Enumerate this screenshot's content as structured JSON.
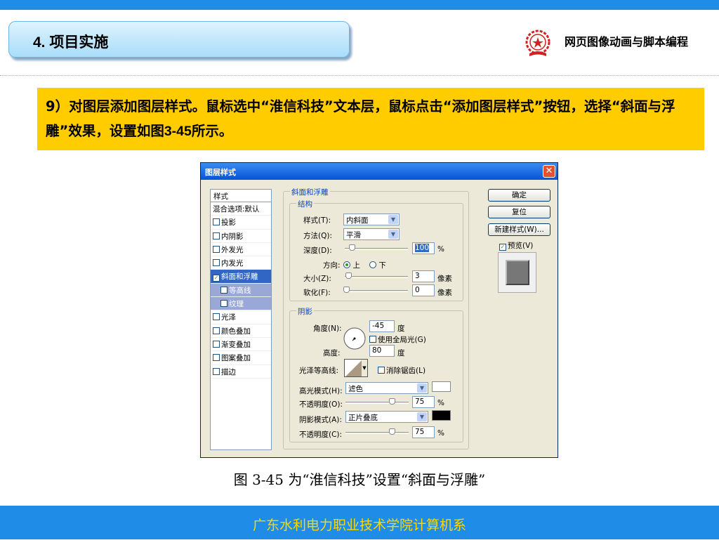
{
  "slide": {
    "title": "4. 项目实施",
    "course_name": "网页图像动画与脚本编程",
    "instruction_num": "9",
    "instruction_text": "）对图层添加图层样式。鼠标选中“淮信科技”文本层，鼠标点击“添加图层样式”按钮，选择“斜面与浮雕”效果，设置如图",
    "instruction_fig": "3-45",
    "instruction_end": "所示。",
    "caption": "图 3-45  为“淮信科技”设置“斜面与浮雕”",
    "footer": "广东水利电力职业技术学院计算机系"
  },
  "dialog": {
    "title": "图层样式",
    "close_glyph": "✕",
    "styles_header": "样式",
    "blend_options": "混合选项:默认",
    "style_items": [
      "投影",
      "内阴影",
      "外发光",
      "内发光",
      "斜面和浮雕",
      "等高线",
      "纹理",
      "光泽",
      "颜色叠加",
      "渐变叠加",
      "图案叠加",
      "描边"
    ],
    "bevel_group": "斜面和浮雕",
    "structure_group": "结构",
    "style_label": "样式(T):",
    "style_value": "内斜面",
    "technique_label": "方法(Q):",
    "technique_value": "平滑",
    "depth_label": "深度(D):",
    "depth_value": "100",
    "depth_unit": "%",
    "direction_label": "方向:",
    "direction_up": "上",
    "direction_down": "下",
    "size_label": "大小(Z):",
    "size_value": "3",
    "size_unit": "像素",
    "soften_label": "软化(F):",
    "soften_value": "0",
    "soften_unit": "像素",
    "shading_group": "阴影",
    "angle_label": "角度(N):",
    "angle_value": "-45",
    "angle_unit": "度",
    "global_light": "使用全局光(G)",
    "altitude_label": "高度:",
    "altitude_value": "80",
    "altitude_unit": "度",
    "gloss_label": "光泽等高线:",
    "anti_alias": "消除锯齿(L)",
    "highlight_label": "高光模式(H):",
    "highlight_value": "滤色",
    "highlight_color": "#ffffff",
    "opacity1_label": "不透明度(O):",
    "opacity1_value": "75",
    "shadow_label": "阴影模式(A):",
    "shadow_value": "正片叠底",
    "shadow_color": "#000000",
    "opacity2_label": "不透明度(C):",
    "opacity2_value": "75",
    "percent": "%",
    "ok_button": "确定",
    "reset_button": "复位",
    "new_style_button": "新建样式(W)...",
    "preview_label": "预览(V)"
  }
}
